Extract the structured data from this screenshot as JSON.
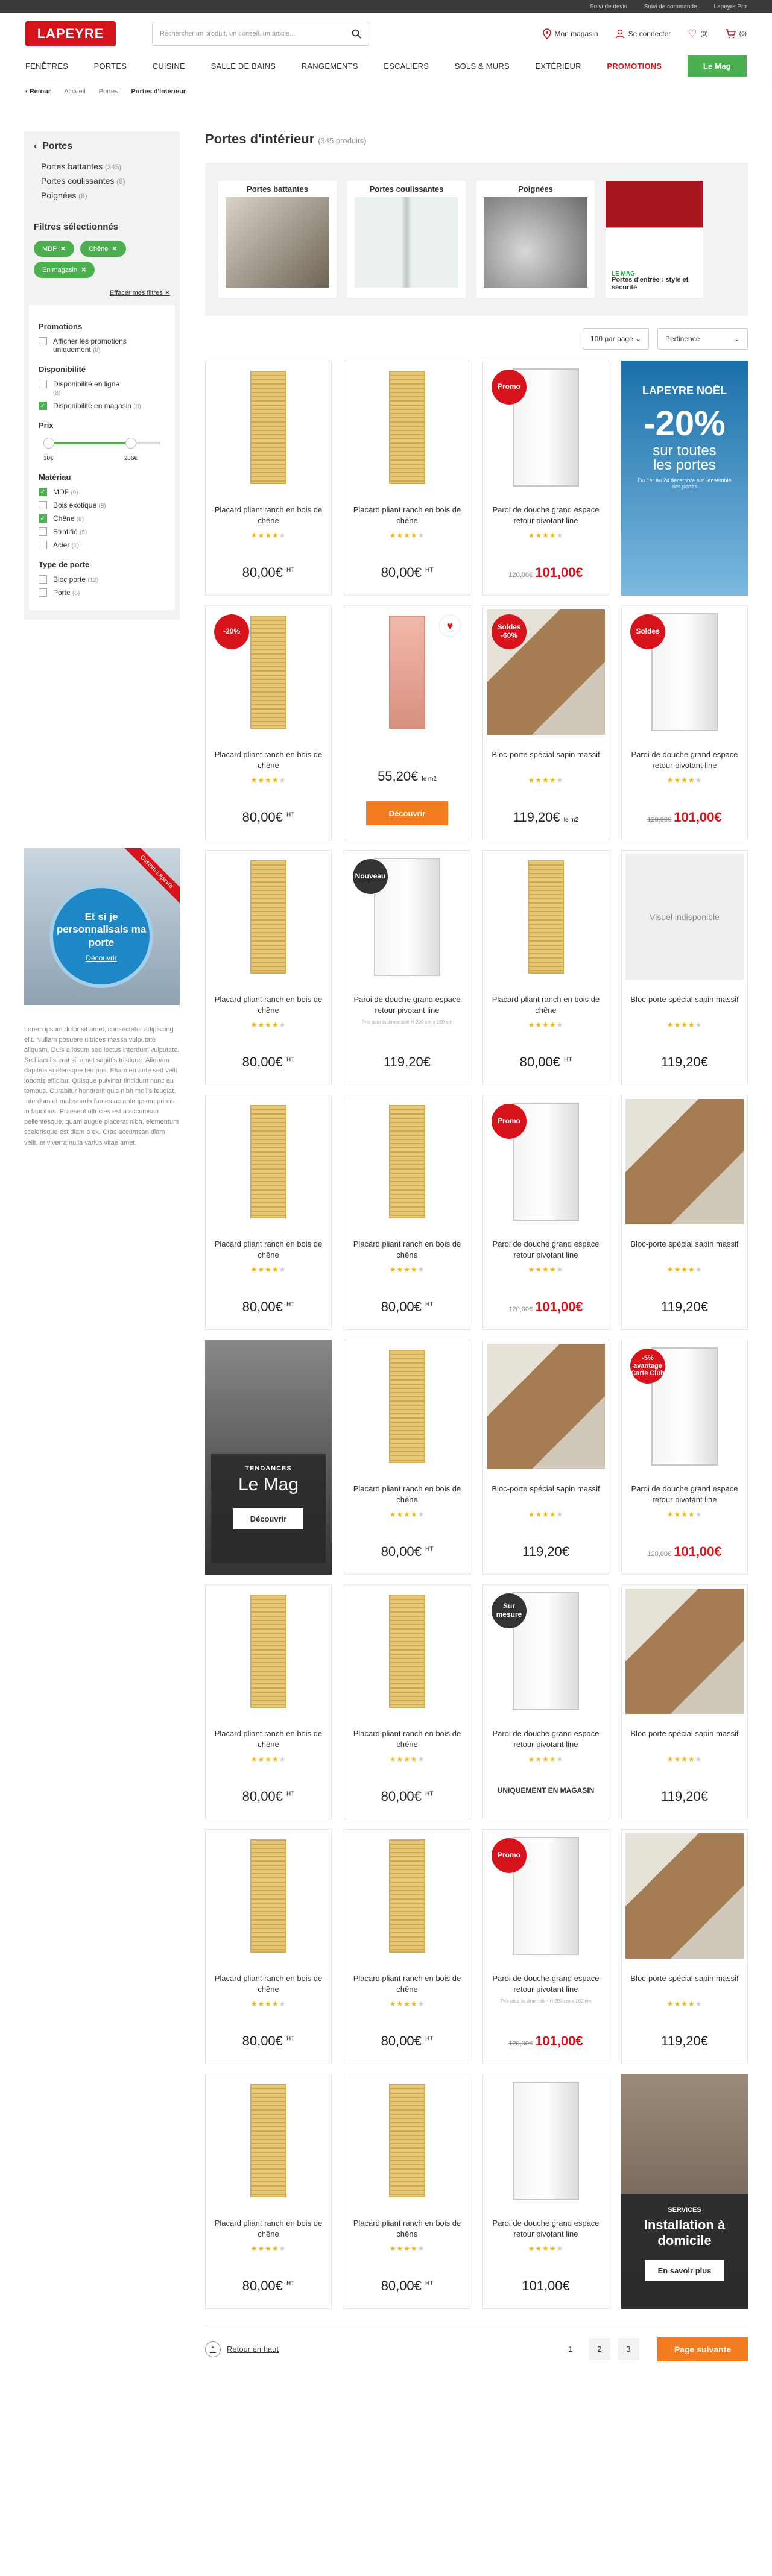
{
  "topbar": {
    "links": [
      "Suivi de devis",
      "Suivi de commande",
      "Lapeyre Pro"
    ]
  },
  "header": {
    "logo": "LAPEYRE",
    "search_placeholder": "Rechercher un produit, un conseil, un article...",
    "store": "Mon magasin",
    "login": "Se connecter",
    "wishlist_count": "(0)",
    "cart_count": "(0)"
  },
  "nav": {
    "items": [
      "Fenêtres",
      "Portes",
      "Cuisine",
      "Salle de bains",
      "Rangements",
      "Escaliers",
      "Sols & murs",
      "Extérieur"
    ],
    "promo": "Promotions",
    "mag": "Le Mag"
  },
  "breadcrumb": {
    "back": "Retour",
    "items": [
      "Accueil",
      "Portes"
    ],
    "current": "Portes d'intérieur"
  },
  "sidebar": {
    "heading": "Portes",
    "categories": [
      {
        "label": "Portes battantes",
        "count": "(345)"
      },
      {
        "label": "Portes coulissantes",
        "count": "(8)"
      },
      {
        "label": "Poignées",
        "count": "(8)"
      }
    ],
    "selected_title": "Filtres sélectionnés",
    "chips": [
      "MDF",
      "Chêne",
      "En magasin"
    ],
    "clear": "Effacer mes filtres",
    "promotions": {
      "title": "Promotions",
      "option": "Afficher les promotions uniquement",
      "count": "(8)"
    },
    "availability": {
      "title": "Disponibilité",
      "options": [
        {
          "label": "Disponibilité en ligne",
          "count": "(8)"
        },
        {
          "label": "Disponibilité en magasin",
          "count": "(8)"
        }
      ]
    },
    "price": {
      "title": "Prix",
      "min": "10€",
      "max": "286€"
    },
    "material": {
      "title": "Matériau",
      "options": [
        {
          "label": "MDF",
          "count": "(9)"
        },
        {
          "label": "Bois exotique",
          "count": "(8)"
        },
        {
          "label": "Chêne",
          "count": "(8)"
        },
        {
          "label": "Stratifié",
          "count": "(5)"
        },
        {
          "label": "Acier",
          "count": "(1)"
        }
      ]
    },
    "door_type": {
      "title": "Type de porte",
      "options": [
        {
          "label": "Bloc porte",
          "count": "(12)"
        },
        {
          "label": "Porte",
          "count": "(8)"
        }
      ]
    }
  },
  "promo_card": {
    "ribbon": "Custom Lapeyre",
    "title": "Et si je personnalisais ma porte",
    "link": "Découvrir"
  },
  "lorem": "Lorem ipsum dolor sit amet, consectetur adipiscing elit. Nullam posuere ultrices massa vulputate aliquam. Duis a ipsum sed lectus interdum vulputate. Sed iaculis erat sit amet sagittis tristique. Aliquam dapibus scelerisque tempus. Etiam eu ante sed velit lobortis efficitur. Quisque pulvinar tincidunt nunc eu tempus. Curabitur hendrerit quis nibh mollis feugiat. Interdum et malesuada fames ac ante ipsum primis in faucibus. Praesent ultricies est a accumsan pellentesque, quam augue placerat nibh, elementum scelerisque est diam a ex. Cras accumsan diam velit, et viverra nulla varius vitae amet.",
  "main": {
    "title": "Portes d'intérieur",
    "count": "(345 produits)",
    "categories": [
      "Portes battantes",
      "Portes coulissantes",
      "Poignées"
    ],
    "mag_tile": {
      "tag": "LE MAG",
      "text": "Portes d'entrée : style et sécurité"
    },
    "per_page": "100 par page",
    "sort": "Pertinence"
  },
  "ads": {
    "noel": {
      "brand": "LAPEYRE NOËL",
      "pct": "-20%",
      "line1": "sur toutes",
      "line2": "les portes",
      "fine": "Du 1er au 24 décembre sur l'ensemble des portes"
    },
    "mag": {
      "kicker": "TENDANCES",
      "title": "Le Mag",
      "button": "Découvrir"
    },
    "service": {
      "kicker": "SERVICES",
      "title": "Installation à domicile",
      "button": "En savoir plus"
    }
  },
  "products": {
    "placard_name": "Placard pliant ranch en bois de chêne",
    "shower_name": "Paroi de douche grand espace retour pivotant line",
    "bloc_name": "Bloc-porte spécial sapin massif",
    "bloc2_name": "Bloc-porte spécial sapin massif",
    "price_80": "80,00€",
    "ht": "HT",
    "price_101": "101,00€",
    "old_120": "120,00€",
    "price_119": "119,20€",
    "price_5520": "55,20€",
    "per_m2": "le m2",
    "stars": "★★★★",
    "star_off": "★",
    "badge_promo": "Promo",
    "badge_20": "-20%",
    "badge_soldes60": "Soldes -60%",
    "badge_soldes": "Soldes",
    "badge_new": "Nouveau",
    "badge_mesure": "Sur mesure",
    "badge_club": "-5% avantage Carte Club",
    "discover": "Découvrir",
    "no_visual": "Visuel indisponible",
    "shop_only": "UNIQUEMENT EN MAGASIN",
    "small_note": "Prix pour la dimension H 200 cm x 160 cm",
    "small_note2": "Prix pour la dimension H 200 cm x 160 cm",
    "price_101_plain": "101,00€"
  },
  "pager": {
    "back_top": "Retour en haut",
    "pages": [
      "1",
      "2",
      "3"
    ],
    "next": "Page suivante"
  }
}
